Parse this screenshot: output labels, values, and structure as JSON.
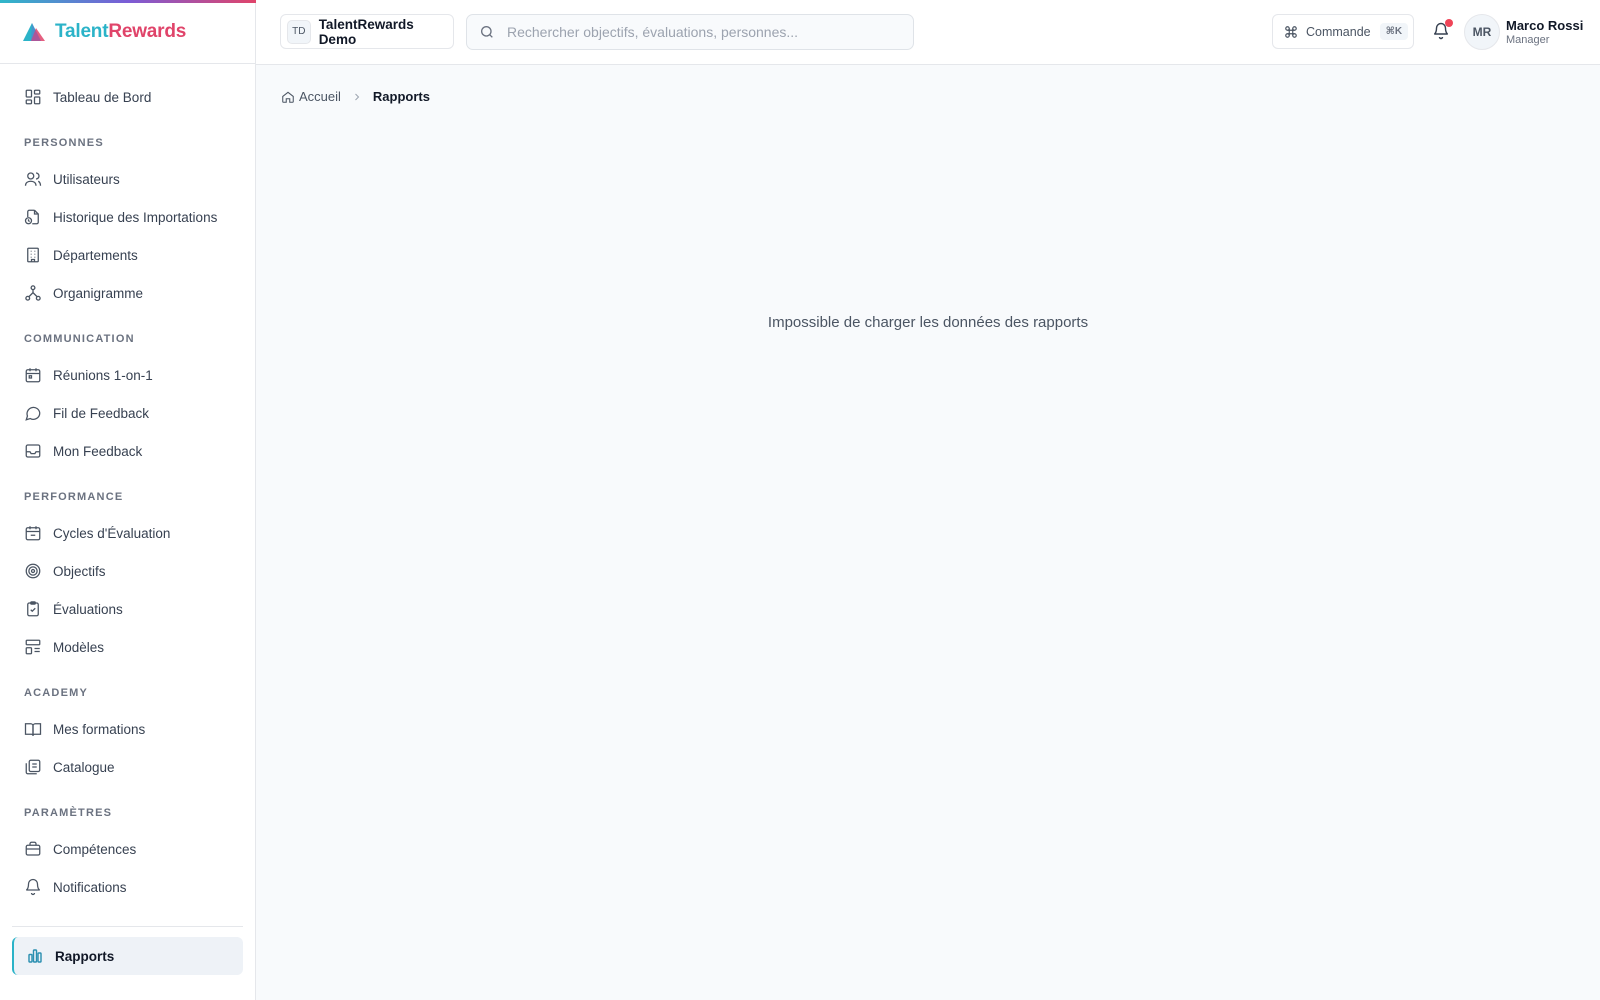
{
  "brand": {
    "name_part1": "Talent",
    "name_part2": "Rewards",
    "logo_icon": "triangle-logo-icon"
  },
  "sidebar": {
    "top_item": {
      "label": "Tableau de Bord",
      "icon": "dashboard-icon"
    },
    "sections": {
      "personnes": {
        "title": "PERSONNES",
        "items": [
          {
            "label": "Utilisateurs",
            "icon": "users-icon"
          },
          {
            "label": "Historique des Importations",
            "icon": "file-history-icon"
          },
          {
            "label": "Départements",
            "icon": "building-icon"
          },
          {
            "label": "Organigramme",
            "icon": "org-chart-icon"
          }
        ]
      },
      "communication": {
        "title": "COMMUNICATION",
        "items": [
          {
            "label": "Réunions 1-on-1",
            "icon": "calendar-icon"
          },
          {
            "label": "Fil de Feedback",
            "icon": "chat-bubble-icon"
          },
          {
            "label": "Mon Feedback",
            "icon": "inbox-icon"
          }
        ]
      },
      "performance": {
        "title": "PERFORMANCE",
        "items": [
          {
            "label": "Cycles d'Évaluation",
            "icon": "calendar-cycle-icon"
          },
          {
            "label": "Objectifs",
            "icon": "target-icon"
          },
          {
            "label": "Évaluations",
            "icon": "clipboard-check-icon"
          },
          {
            "label": "Modèles",
            "icon": "template-icon"
          }
        ]
      },
      "academy": {
        "title": "ACADEMY",
        "items": [
          {
            "label": "Mes formations",
            "icon": "book-open-icon"
          },
          {
            "label": "Catalogue",
            "icon": "library-icon"
          }
        ]
      },
      "parametres": {
        "title": "PARAMÈTRES",
        "items": [
          {
            "label": "Compétences",
            "icon": "briefcase-icon"
          },
          {
            "label": "Notifications",
            "icon": "bell-icon"
          }
        ]
      }
    },
    "active_item": {
      "label": "Rapports",
      "icon": "bar-chart-icon"
    }
  },
  "header": {
    "org": {
      "badge": "TD",
      "name": "TalentRewards Demo"
    },
    "search": {
      "placeholder": "Rechercher objectifs, évaluations, personnes...",
      "value": ""
    },
    "command": {
      "label": "Commande",
      "shortcut": "⌘K"
    },
    "user": {
      "initials": "MR",
      "name": "Marco Rossi",
      "role": "Manager"
    }
  },
  "breadcrumb": {
    "home": "Accueil",
    "current": "Rapports"
  },
  "main": {
    "error_message": "Impossible de charger les données des rapports"
  },
  "colors": {
    "brand_teal": "#2bb3c8",
    "brand_pink": "#e0446a",
    "notification_dot": "#ef4457"
  }
}
